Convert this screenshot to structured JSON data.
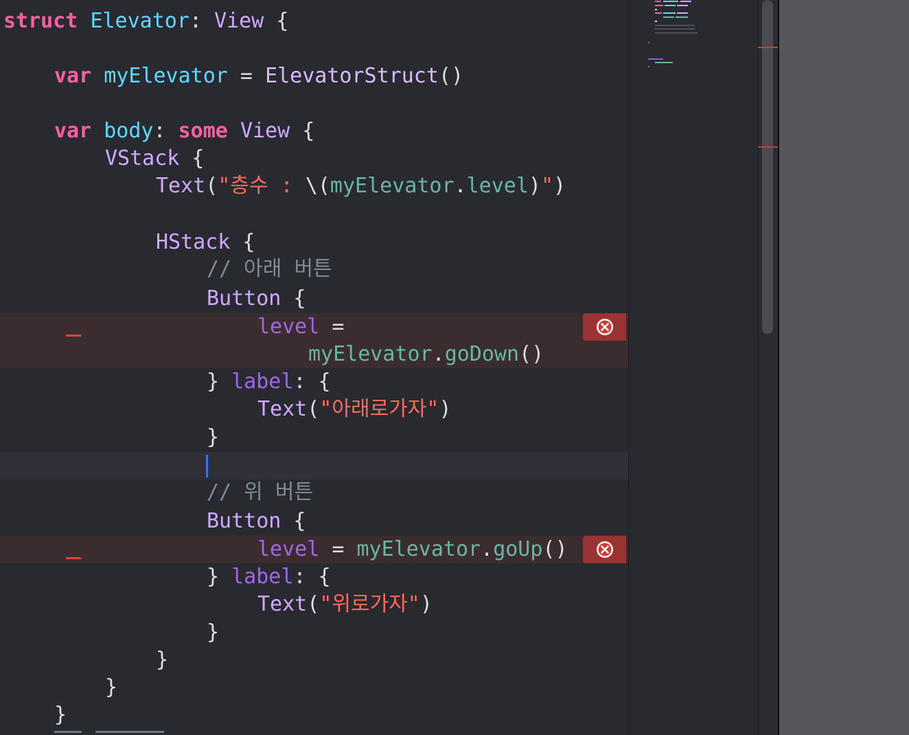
{
  "code": {
    "line1": {
      "kw": "struct",
      "name": "Elevator",
      "colon": ": ",
      "type": "View",
      "tail": " {"
    },
    "line3": {
      "kw": "var",
      "name": "myElevator",
      "op": " = ",
      "type": "ElevatorStruct",
      "tail": "()"
    },
    "line5": {
      "kw1": "var",
      "name": "body",
      "colon": ": ",
      "kw2": "some",
      "type": "View",
      "tail": " {"
    },
    "line6": {
      "type": "VStack",
      "tail": " {"
    },
    "line7": {
      "type": "Text",
      "open": "(",
      "str1": "\"층수 : ",
      "interp_open": "\\(",
      "obj": "myElevator",
      "dot": ".",
      "prop": "level",
      "interp_close": ")",
      "str2": "\"",
      "close": ")"
    },
    "line9": {
      "type": "HStack",
      "tail": " {"
    },
    "line10": {
      "comment": "// 아래 버튼"
    },
    "line11": {
      "type": "Button",
      "tail": " {"
    },
    "line12": {
      "var": "level",
      "op": " ="
    },
    "line13": {
      "obj": "myElevator",
      "dot": ".",
      "method": "goDown",
      "tail": "()"
    },
    "line14": {
      "brace": "} ",
      "label": "label",
      "tail": ": {"
    },
    "line15": {
      "type": "Text",
      "open": "(",
      "str": "\"아래로가자\"",
      "close": ")"
    },
    "line16": {
      "brace": "}"
    },
    "line18": {
      "comment": "// 위 버튼"
    },
    "line19": {
      "type": "Button",
      "tail": " {"
    },
    "line20": {
      "var": "level",
      "op": " = ",
      "obj": "myElevator",
      "dot": ".",
      "method": "goUp",
      "tail": "()"
    },
    "line21": {
      "brace": "} ",
      "label": "label",
      "tail": ": {"
    },
    "line22": {
      "type": "Text",
      "open": "(",
      "str": "\"위로가자\"",
      "close": ")"
    },
    "line23": {
      "brace": "}"
    },
    "line24": {
      "brace": "}"
    },
    "line25": {
      "brace": "}"
    },
    "line26": {
      "brace": "}"
    }
  },
  "errors": {
    "icon": "error-x-circle-icon",
    "count": 2
  },
  "colors": {
    "background": "#292a30",
    "keyword": "#fc5fa3",
    "type": "#d0a8ff",
    "declaration": "#5dd8ff",
    "string": "#fc6a5d",
    "comment": "#7f8c98",
    "error_badge": "#9b3333",
    "error_line": "#3b2d2f",
    "caret": "#3b6ff6"
  }
}
